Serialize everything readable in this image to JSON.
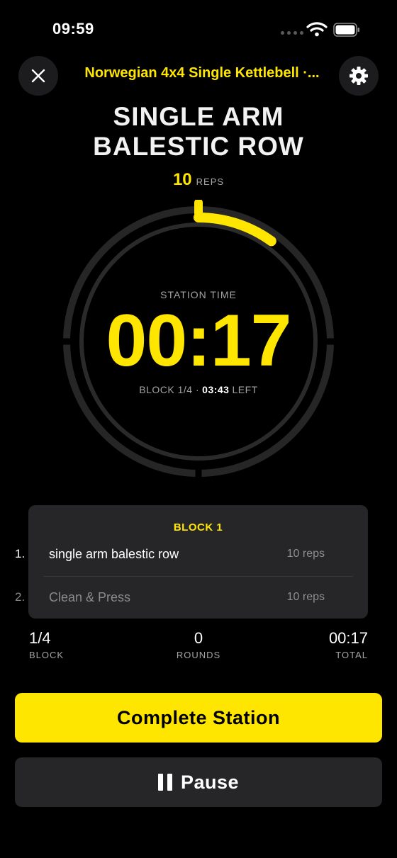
{
  "status_bar": {
    "time": "09:59"
  },
  "header": {
    "title": "Norwegian 4x4 Single Kettlebell ·...",
    "close_icon": "close-icon",
    "settings_icon": "gear-icon"
  },
  "exercise": {
    "name_line1": "SINGLE ARM",
    "name_line2": "BALESTIC ROW",
    "reps_value": "10",
    "reps_label": "REPS",
    "rep_progress": 0.1
  },
  "timer": {
    "label": "STATION TIME",
    "value": "00:17",
    "block_text": "BLOCK 1/4 ·",
    "left_time": "03:43",
    "left_label": "LEFT"
  },
  "block_card": {
    "title": "BLOCK 1",
    "items": [
      {
        "index": "1.",
        "name": "single arm balestic row",
        "reps": "10 reps"
      },
      {
        "index": "2.",
        "name": "Clean & Press",
        "reps": "10 reps"
      }
    ]
  },
  "stats": {
    "block": {
      "value": "1/4",
      "label": "BLOCK"
    },
    "rounds": {
      "value": "0",
      "label": "ROUNDS"
    },
    "total": {
      "value": "00:17",
      "label": "TOTAL"
    }
  },
  "actions": {
    "complete_label": "Complete Station",
    "pause_label": "Pause"
  },
  "colors": {
    "accent": "#ffe600",
    "card": "#262628",
    "background": "#000000"
  }
}
